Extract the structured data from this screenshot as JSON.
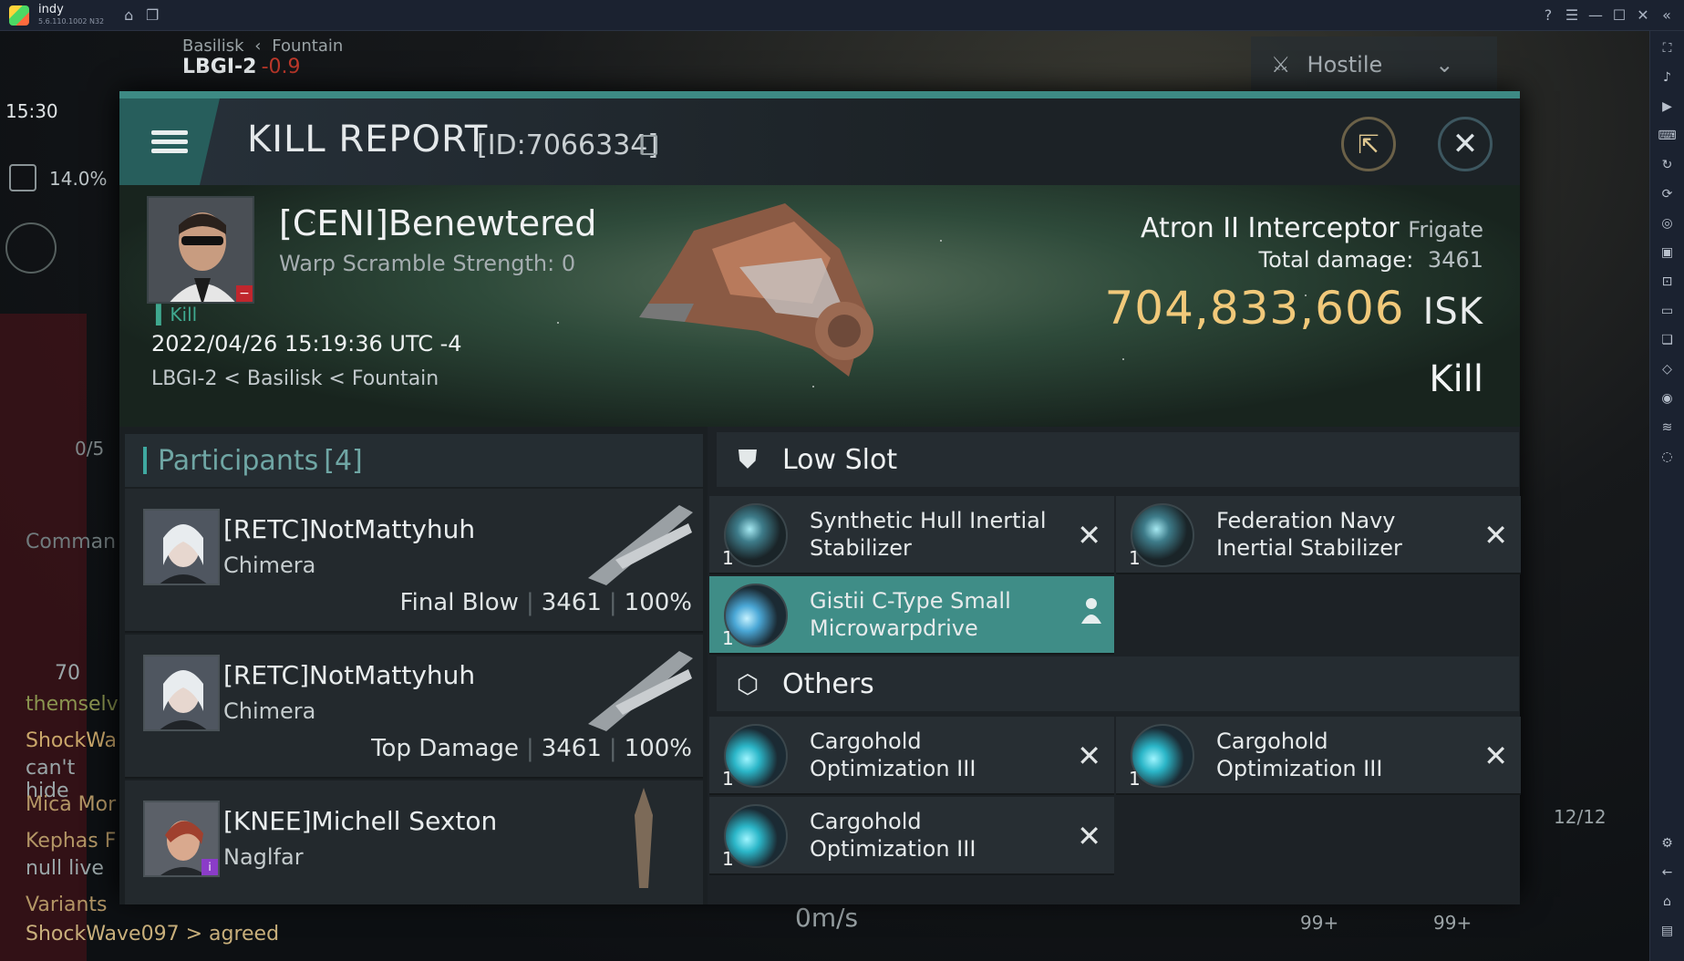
{
  "window": {
    "app_name": "indy",
    "app_version": "5.6.110.1002 N32"
  },
  "hud": {
    "region": "Basilisk",
    "constellation": "Fountain",
    "system": "LBGI-2",
    "security": "-0.9",
    "time": "15:30",
    "cargo_pct": "14.0%",
    "overview_filter": "Hostile",
    "speed": "0m/s",
    "ammo_count": "12/12",
    "chat": [
      {
        "text": "Comman"
      },
      {
        "text": "70"
      },
      {
        "text": "themselv"
      },
      {
        "text": "ShockWa"
      },
      {
        "text": "can't hide"
      },
      {
        "text": "Mica Mor"
      },
      {
        "text": "Kephas F"
      },
      {
        "text": "null live"
      },
      {
        "text": "Variants"
      },
      {
        "text": "ShockWave097 > agreed"
      }
    ],
    "badges": [
      "99+",
      "99+"
    ],
    "count_label": "0/5"
  },
  "kill_report": {
    "title": "KILL REPORT",
    "id_label": "[ID:7066334]",
    "victim": {
      "name": "[CENI]Benewtered",
      "warp_scramble": "Warp Scramble Strength: 0",
      "tag": "Kill",
      "datetime": "2022/04/26 15:19:36 UTC -4",
      "location": "LBGI-2 < Basilisk < Fountain",
      "ship_name": "Atron II Interceptor",
      "ship_class": "Frigate",
      "total_damage_label": "Total damage:",
      "total_damage": "3461",
      "isk_value": "704,833,606",
      "isk_unit": "ISK",
      "result": "Kill"
    },
    "participants": {
      "label": "Participants",
      "count": "[4]",
      "rows": [
        {
          "name": "[RETC]NotMattyhuh",
          "ship": "Chimera",
          "role": "Final Blow",
          "damage": "3461",
          "percent": "100%"
        },
        {
          "name": "[RETC]NotMattyhuh",
          "ship": "Chimera",
          "role": "Top Damage",
          "damage": "3461",
          "percent": "100%"
        },
        {
          "name": "[KNEE]Michell Sexton",
          "ship": "Naglfar",
          "role": "",
          "damage": "",
          "percent": ""
        }
      ]
    },
    "low_slot": {
      "label": "Low Slot",
      "modules": [
        {
          "name": "Synthetic Hull Inertial Stabilizer",
          "qty": "1",
          "status": "destroyed"
        },
        {
          "name": "Federation Navy Inertial Stabilizer",
          "qty": "1",
          "status": "destroyed"
        },
        {
          "name": "Gistii C-Type Small Microwarpdrive",
          "qty": "1",
          "status": "dropped"
        }
      ]
    },
    "others": {
      "label": "Others",
      "modules": [
        {
          "name": "Cargohold Optimization III",
          "qty": "1",
          "status": "destroyed"
        },
        {
          "name": "Cargohold Optimization III",
          "qty": "1",
          "status": "destroyed"
        },
        {
          "name": "Cargohold Optimization III",
          "qty": "1",
          "status": "destroyed"
        }
      ]
    }
  },
  "colors": {
    "accent": "#3f8d87",
    "isk": "#f1c97a",
    "security": "#c0392b"
  }
}
